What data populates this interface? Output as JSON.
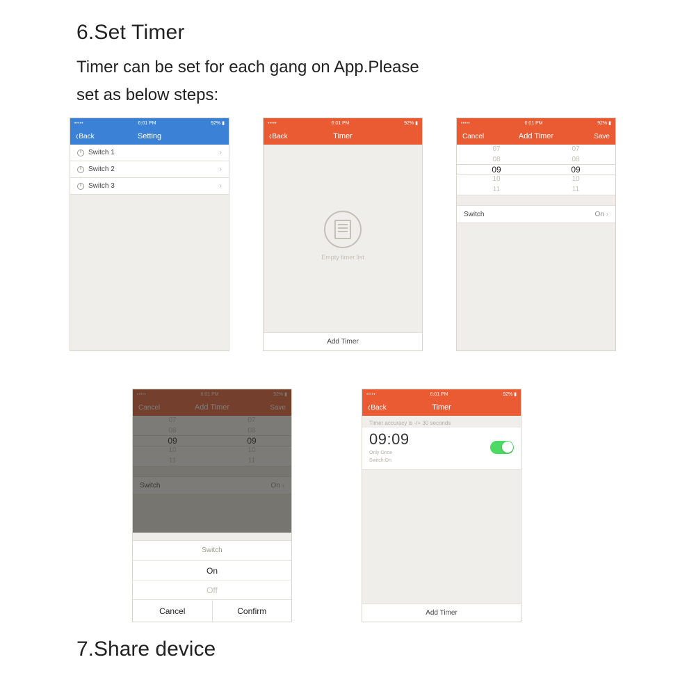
{
  "section6": {
    "heading": "6.Set Timer",
    "desc_l1": "Timer can be set for each gang on App.Please",
    "desc_l2": "set as below steps:"
  },
  "section7": {
    "heading": "7.Share device"
  },
  "status": {
    "time": "6:01 PM",
    "batt": "92%"
  },
  "nav": {
    "back": "Back",
    "cancel": "Cancel",
    "save": "Save",
    "setting": "Setting",
    "timer": "Timer",
    "add_timer": "Add Timer"
  },
  "screen1": {
    "items": [
      {
        "label": "Switch 1"
      },
      {
        "label": "Switch 2"
      },
      {
        "label": "Switch 3"
      }
    ]
  },
  "screen2": {
    "empty_label": "Empty timer list",
    "add_btn": "Add Timer"
  },
  "screen3": {
    "picker": {
      "hh": [
        "07",
        "08",
        "09",
        "10",
        "11"
      ],
      "mm": [
        "07",
        "08",
        "09",
        "10",
        "11"
      ],
      "sel_index": 2
    },
    "switch_label": "Switch",
    "switch_value": "On"
  },
  "screen4": {
    "sheet_title": "Switch",
    "opt_on": "On",
    "opt_off": "Off",
    "cancel": "Cancel",
    "confirm": "Confirm"
  },
  "screen5": {
    "hint": "Timer accuracy is -/+ 30 seconds",
    "time": "09:09",
    "sub1": "Only Once",
    "sub2": "Switch:On",
    "add_btn": "Add Timer"
  }
}
